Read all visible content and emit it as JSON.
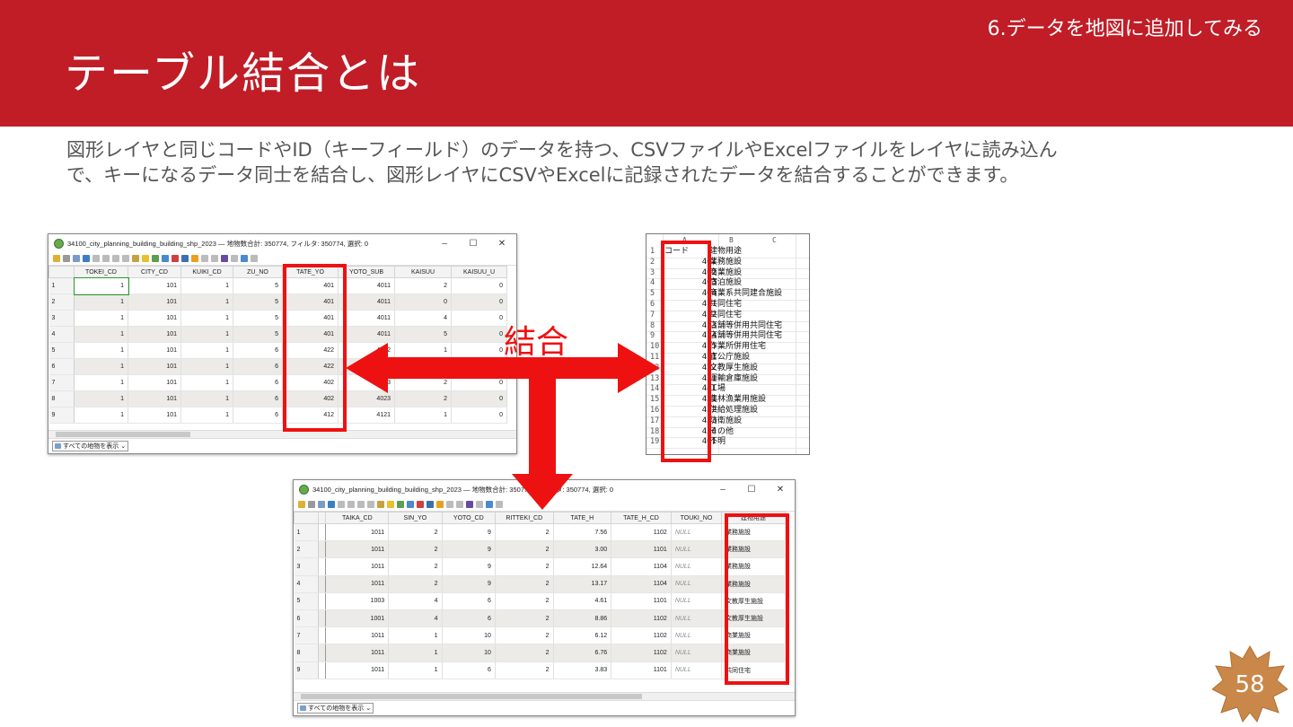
{
  "slide": {
    "section": "6.データを地図に追加してみる",
    "title": "テーブル結合とは",
    "description_lines": [
      "図形レイヤと同じコードやID（キーフィールド）のデータを持つ、CSVファイルやExcelファイルをレイヤに読み込ん",
      "で、キーになるデータ同士を結合し、図形レイヤにCSVやExcelに記録されたデータを結合することができます。"
    ],
    "label_join": "結合",
    "page_number": "58"
  },
  "colors": {
    "header": "#c01d27",
    "highlight": "#ee1111",
    "badge": "#c9884a"
  },
  "table1": {
    "title": "34100_city_planning_building_building_shp_2023 — 地物数合計: 350774, フィルタ: 350774, 選択: 0",
    "columns": [
      "TOKEI_CD",
      "CITY_CD",
      "KUIKI_CD",
      "ZU_NO",
      "TATE_YO",
      "YOTO_SUB",
      "KAISUU",
      "KAISUU_U"
    ],
    "rows": [
      [
        "1",
        "1",
        "101",
        "1",
        "5",
        "401",
        "4011",
        "2",
        "0"
      ],
      [
        "2",
        "1",
        "101",
        "1",
        "5",
        "401",
        "4011",
        "0",
        "0"
      ],
      [
        "3",
        "1",
        "101",
        "1",
        "5",
        "401",
        "4011",
        "4",
        "0"
      ],
      [
        "4",
        "1",
        "101",
        "1",
        "5",
        "401",
        "4011",
        "5",
        "0"
      ],
      [
        "5",
        "1",
        "101",
        "1",
        "6",
        "422",
        "4222",
        "1",
        "0"
      ],
      [
        "6",
        "1",
        "101",
        "1",
        "6",
        "422",
        "",
        "",
        ""
      ],
      [
        "7",
        "1",
        "101",
        "1",
        "6",
        "402",
        "4023",
        "2",
        "0"
      ],
      [
        "8",
        "1",
        "101",
        "1",
        "6",
        "402",
        "4023",
        "2",
        "0"
      ],
      [
        "9",
        "1",
        "101",
        "1",
        "6",
        "412",
        "4121",
        "1",
        "0"
      ]
    ],
    "status_button": "すべての地物を表示"
  },
  "excel": {
    "col_headers": [
      "A",
      "B",
      "C"
    ],
    "rows": [
      [
        "1",
        "コード",
        "建物用途"
      ],
      [
        "2",
        "401",
        "業務施設"
      ],
      [
        "3",
        "402",
        "商業施設"
      ],
      [
        "4",
        "403",
        "宿泊施設"
      ],
      [
        "5",
        "404",
        "商業系共同建合施設"
      ],
      [
        "6",
        "411",
        "共同住宅"
      ],
      [
        "7",
        "412",
        "共同住宅"
      ],
      [
        "8",
        "413",
        "店舗等併用共同住宅"
      ],
      [
        "9",
        "414",
        "店舗等併用共同住宅"
      ],
      [
        "10",
        "415",
        "作業所併用住宅"
      ],
      [
        "11",
        "421",
        "官公庁施設"
      ],
      [
        "12",
        "422",
        "文教厚生施設"
      ],
      [
        "13",
        "431",
        "運輸倉庫施設"
      ],
      [
        "14",
        "441",
        "工場"
      ],
      [
        "15",
        "451",
        "農林漁業用施設"
      ],
      [
        "16",
        "452",
        "供給処理施設"
      ],
      [
        "17",
        "453",
        "防衛施設"
      ],
      [
        "18",
        "454",
        "その他"
      ],
      [
        "19",
        "461",
        "不明"
      ]
    ]
  },
  "table2": {
    "title": "34100_city_planning_building_building_shp_2023 — 地物数合計: 350774, フィルタ: 350774, 選択: 0",
    "columns": [
      "TAIKA_CD",
      "SIN_YO",
      "YOTO_CD",
      "RITTEKI_CD",
      "TATE_H",
      "TATE_H_CD",
      "TOUKI_NO",
      "建物用途"
    ],
    "rows": [
      [
        "1",
        "1011",
        "2",
        "9",
        "2",
        "7.56",
        "1102",
        "NULL",
        "業務施設"
      ],
      [
        "2",
        "1011",
        "2",
        "9",
        "2",
        "3.00",
        "1101",
        "NULL",
        "業務施設"
      ],
      [
        "3",
        "1011",
        "2",
        "9",
        "2",
        "12.64",
        "1104",
        "NULL",
        "業務施設"
      ],
      [
        "4",
        "1011",
        "2",
        "9",
        "2",
        "13.17",
        "1104",
        "NULL",
        "業務施設"
      ],
      [
        "5",
        "1003",
        "4",
        "6",
        "2",
        "4.61",
        "1101",
        "NULL",
        "文教厚生施設"
      ],
      [
        "6",
        "1001",
        "4",
        "6",
        "2",
        "8.86",
        "1102",
        "NULL",
        "文教厚生施設"
      ],
      [
        "7",
        "1011",
        "1",
        "10",
        "2",
        "6.12",
        "1102",
        "NULL",
        "商業施設"
      ],
      [
        "8",
        "1011",
        "1",
        "10",
        "2",
        "6.76",
        "1102",
        "NULL",
        "商業施設"
      ],
      [
        "9",
        "1011",
        "1",
        "6",
        "2",
        "3.83",
        "1101",
        "NULL",
        "共同住宅"
      ]
    ],
    "status_button": "すべての地物を表示"
  }
}
